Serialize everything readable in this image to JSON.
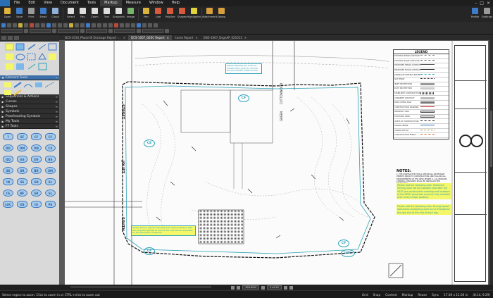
{
  "menu": {
    "items": [
      "File",
      "Edit",
      "View",
      "Document",
      "Tools",
      "Markup",
      "Measure",
      "Window",
      "Help"
    ],
    "active_index": 5
  },
  "ribbon": {
    "buttons": [
      {
        "label": "Open",
        "color": "#e2b23c"
      },
      {
        "label": "Save",
        "color": "#3d7cc9"
      },
      {
        "label": "Print",
        "color": "#9a9a9a"
      },
      {
        "label": "Email",
        "color": "#3d7cc9"
      },
      {
        "label": "Cloud",
        "color": "#8fb0d8"
      },
      {
        "label": "Select",
        "color": "#dddddd"
      },
      {
        "label": "Pan",
        "color": "#dddddd"
      },
      {
        "label": "Zoom",
        "color": "#dddddd"
      },
      {
        "label": "Text",
        "color": "#dddddd"
      },
      {
        "label": "Snapshot",
        "color": "#dddddd"
      },
      {
        "label": "Image",
        "color": "#78b46a"
      },
      {
        "label": "Pen",
        "color": "#d8b43c"
      },
      {
        "label": "Line",
        "color": "#d85a3c"
      },
      {
        "label": "Polyline",
        "color": "#d85a3c"
      },
      {
        "label": "Shapes",
        "color": "#d85a3c"
      },
      {
        "label": "Highlighter",
        "color": "#e2d23c"
      },
      {
        "label": "Attachment",
        "color": "#d8a03c"
      },
      {
        "label": "Stamp",
        "color": "#d8a03c"
      }
    ],
    "right_buttons": [
      {
        "label": "Profile",
        "color": "#3d7cc9"
      },
      {
        "label": "Settings",
        "color": "#9a9a9a"
      }
    ]
  },
  "tabs": [
    {
      "label": "DCS-1010_Phase IB Drainage Report -...",
      "active": false
    },
    {
      "label": "DCS-1007_GESC Report",
      "active": true
    },
    {
      "label": "Cases Report",
      "active": false
    },
    {
      "label": "DSD-1007_DsgnAP_021013",
      "active": false
    }
  ],
  "left_panel": {
    "sections": [
      {
        "label": "Element Tools",
        "selected": true
      },
      {
        "label": "Sequences & Actions",
        "selected": false
      },
      {
        "label": "Curves",
        "selected": false
      },
      {
        "label": "Shapes",
        "selected": false
      },
      {
        "label": "Symbols",
        "selected": false
      },
      {
        "label": "Proofreading Symbols",
        "selected": false
      },
      {
        "label": "My Tools",
        "selected": false
      },
      {
        "label": "FF Tools",
        "selected": false
      }
    ],
    "stamps": [
      "?",
      "SF",
      "CF",
      "CC",
      "DD",
      "OM",
      "ON",
      "CS",
      "QQ",
      "GS",
      "DS",
      "BS",
      "SS",
      "SR",
      "BR",
      "SM",
      "IN",
      "SS",
      "GR",
      "SL",
      "CE",
      "BF",
      "SR",
      "SL",
      "LOC",
      "OS",
      "IO",
      "PS"
    ]
  },
  "drawing": {
    "legend_title": "LEGEND",
    "legend_rows": [
      "EXISTING MINOR CONTOUR",
      "EXISTING MAJOR CONTOUR",
      "PROPOSED MINOR CONTOUR",
      "PROPOSED MAJOR CONTOUR",
      "DRAINAGE CONTROL BOUNDARY",
      "SILT FENCE",
      "INLET PROTECTION",
      "DUST PROTECTION",
      "STABILIZED CONSTRUCTION",
      "CONCRETE WASHOUT",
      "ROCK CHECK DAM",
      "CONSTRUCTION MARKERS",
      "SEDIMENT TRAP",
      "STOCKPILE AREA",
      "LIMITS OF CONSTRUCTION",
      "STORM SEWER",
      "STRAW WATTLE",
      "CONSTRUCTION FENCE"
    ],
    "street_labels": [
      "SOUTH",
      "JOLIET",
      "STREET",
      "COTTONWOOD",
      "GREEN"
    ],
    "notes_title": "NOTES:",
    "notes_small": "1. THE CONTRACTOR SHALL OBTAIN ALL NECESSARY PERMITS PRIOR TO CONSTRUCTION AND FOLLOW ALL REQUIREMENTS OF THE GESC PERMIT. 2. ALL EROSION CONTROL MEASURES SHALL BE INSTALLED PER STANDARDS.",
    "highlight_notes": [
      "Please add the following note: Sediment fencing shall not be installed until after the GESC pre-construction meeting and locations of the GESC perimeter must be fully installed prior to any major grading.",
      "Please add the following note: During topsoil operations stockpiling shall occur throughout the day and at the end of each day."
    ],
    "callouts": [
      "Please stabilize the limits of construction (LOC) to include the stormwater outlet access",
      "Please show a typical drainage area inlet protection with the proposed grades to ensure the inlet will be adequate for the proposed conditions."
    ],
    "tags": [
      "CF",
      "CE",
      "CF",
      "CF",
      "LOC"
    ]
  },
  "page_nav": {
    "zoom": "100.00%",
    "page": "1 of 10"
  },
  "status": {
    "message": "Select region to zoom. Click to zoom in or CTRL+click to zoom out",
    "toggles": [
      "Grid",
      "Snap",
      "Content",
      "Markup",
      "Reuse",
      "Sync"
    ],
    "page_size": "17.00 x 11.00 in",
    "coordinates": "(8.14, 9.29)"
  },
  "colors": {
    "accent": "#3d6fa8",
    "markup": "#2ea3b8",
    "highlight": "#f4f76a"
  }
}
